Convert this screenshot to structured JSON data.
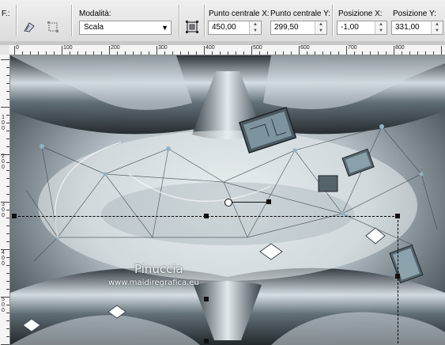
{
  "toolbar": {
    "truncated_label": "F.:",
    "mode_label": "Modalità:",
    "mode_value": "Scala",
    "center_x_label": "Punto centrale X:",
    "center_x_value": "450,00",
    "center_y_label": "Punto centrale Y:",
    "center_y_value": "299,50",
    "pos_x_label": "Posizione X:",
    "pos_x_value": "-1,00",
    "pos_y_label": "Posizione Y:",
    "pos_y_value": "331,00",
    "icons": [
      "pick-tool-icon",
      "free-transform-icon",
      "center-transform-icon"
    ]
  },
  "ruler": {
    "top_labels": [
      "0",
      "100",
      "200",
      "300",
      "400",
      "500",
      "600",
      "700",
      "800"
    ],
    "left_labels": [
      "1\n0\n0",
      "2\n0\n0",
      "3\n0\n0",
      "4\n0\n0",
      "5\n0\n0"
    ]
  },
  "watermark": {
    "name": "Pinuccia",
    "url": "www.maidiregrafica.eu"
  },
  "colors": {
    "toolbar_bg": "#e8e8e8",
    "selection_line": "#000000",
    "canvas_tint": "#8fa3ad"
  }
}
